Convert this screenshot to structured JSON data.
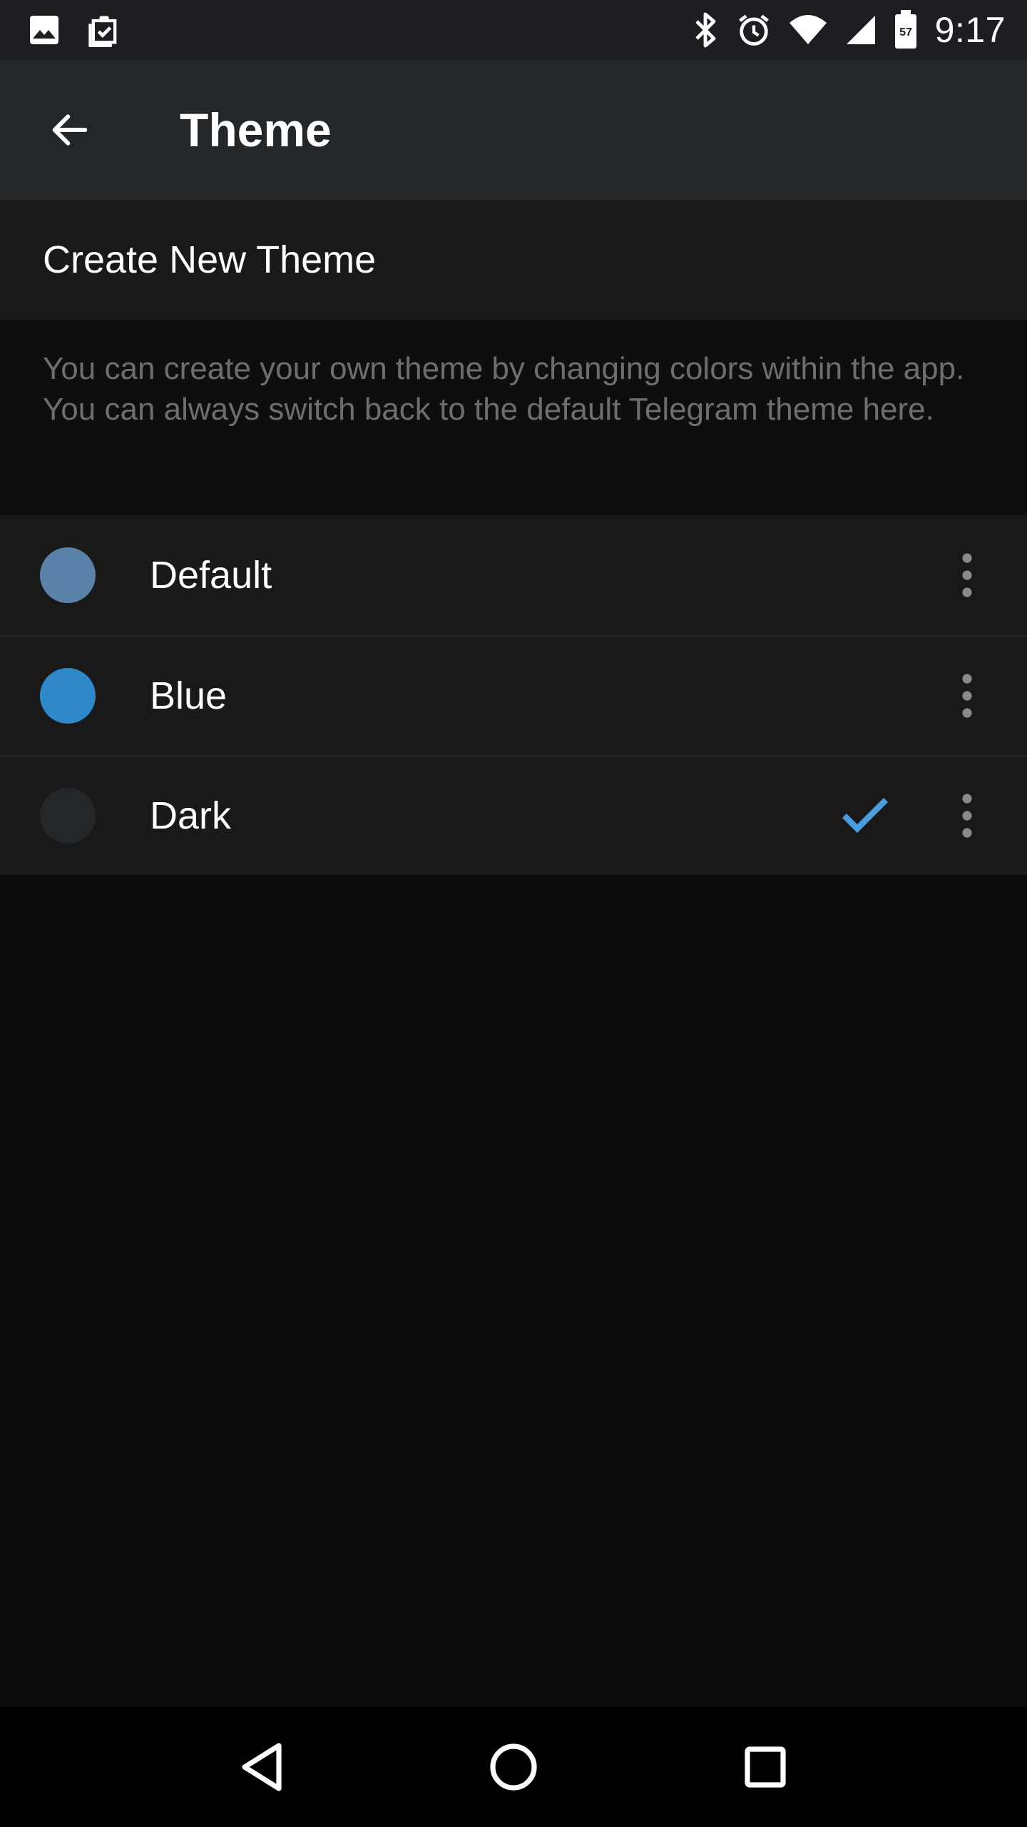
{
  "status_bar": {
    "time": "9:17",
    "battery_level": "57",
    "left_icons": [
      "image-icon",
      "clipboard-check-icon"
    ],
    "right_icons": [
      "bluetooth-icon",
      "alarm-icon",
      "wifi-icon",
      "cell-signal-icon",
      "battery-icon"
    ]
  },
  "app_bar": {
    "title": "Theme",
    "back_icon": "arrow-back-icon"
  },
  "create_theme": {
    "label": "Create New Theme"
  },
  "info": {
    "text": "You can create your own theme by changing colors within the app. You can always switch back to the default Telegram theme here."
  },
  "themes": [
    {
      "name": "Default",
      "color": "#5a82a8",
      "selected": false
    },
    {
      "name": "Blue",
      "color": "#2f88c8",
      "selected": false
    },
    {
      "name": "Dark",
      "color": "#24272a",
      "selected": true
    }
  ],
  "colors": {
    "accent": "#4a9ee0",
    "background": "#0c0c0c",
    "surface": "#19191a",
    "app_bar": "#24272a"
  },
  "nav_bar": {
    "buttons": [
      "back-triangle-icon",
      "home-circle-icon",
      "recents-square-icon"
    ]
  }
}
